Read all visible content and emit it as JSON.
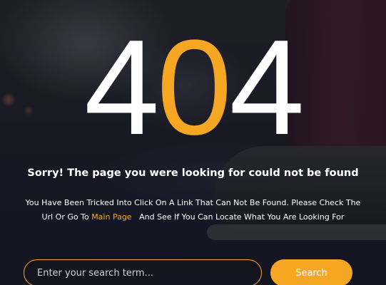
{
  "error_code": {
    "first": "4",
    "middle": "0",
    "last": "4"
  },
  "headline": "Sorry! The page you were looking for could not be found",
  "message": {
    "before_link": "You Have Been Tricked Into Click On A Link That Can Not Be Found. Please Check The Url Or Go To ",
    "link_text": "Main Page",
    "after_link": "   And See If You Can Locate What You Are Looking For"
  },
  "search": {
    "placeholder": "Enter your search term...",
    "value": "",
    "button_label": "Search"
  },
  "colors": {
    "accent": "#f5a623",
    "text": "#ffffff"
  }
}
